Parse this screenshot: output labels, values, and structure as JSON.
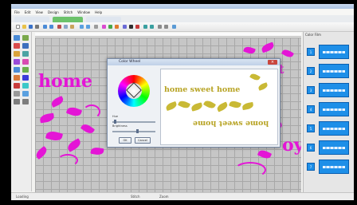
{
  "menu": {
    "items": [
      "File",
      "Edit",
      "View",
      "Design",
      "Stitch",
      "Window",
      "Help"
    ]
  },
  "canvas": {
    "words": [
      "home",
      "sweet",
      "oy"
    ]
  },
  "dialog": {
    "title": "Color Wheel",
    "ok_label": "OK",
    "cancel_label": "Cancel",
    "slider1_label": "Hue",
    "slider2_label": "Brightness"
  },
  "preview": {
    "line1": "home sweet home",
    "line2": "home sweet home"
  },
  "right_panel": {
    "title": "Color Film",
    "items": [
      "1",
      "2",
      "3",
      "4",
      "5",
      "6",
      "7"
    ]
  },
  "status": {
    "left": "Loading",
    "mid": "Stitch",
    "right": "Zoom"
  },
  "colors": {
    "accent": "#e415d6",
    "preview_gold": "#b7a323",
    "thumb_blue": "#1e8fe8"
  }
}
